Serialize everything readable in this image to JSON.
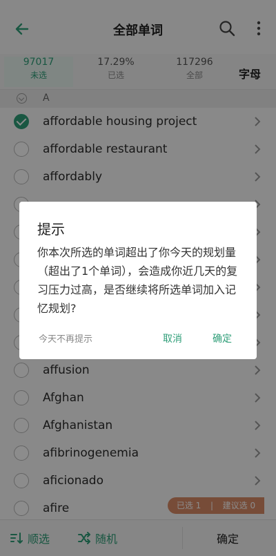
{
  "header": {
    "title": "全部单词",
    "back_icon": "arrow-left-icon",
    "search_icon": "search-icon",
    "more_icon": "more-vertical-icon"
  },
  "stats": [
    {
      "num": "97017",
      "label": "未选"
    },
    {
      "num": "17.29%",
      "label": "已选"
    },
    {
      "num": "117296",
      "label": "全部"
    }
  ],
  "letter_tab": "字母",
  "section": {
    "letter": "A"
  },
  "rows": [
    {
      "word": "affordable housing project",
      "checked": true
    },
    {
      "word": "affordable restaurant",
      "checked": false
    },
    {
      "word": "affordably",
      "checked": false
    },
    {
      "word": "",
      "checked": false
    },
    {
      "word": "",
      "checked": false
    },
    {
      "word": "",
      "checked": false
    },
    {
      "word": "",
      "checked": false
    },
    {
      "word": "",
      "checked": false
    },
    {
      "word": "",
      "checked": false
    },
    {
      "word": "affusion",
      "checked": false
    },
    {
      "word": "Afghan",
      "checked": false
    },
    {
      "word": "Afghanistan",
      "checked": false
    },
    {
      "word": "afibrinogenemia",
      "checked": false
    },
    {
      "word": "aficionado",
      "checked": false
    },
    {
      "word": "afire",
      "checked": false
    }
  ],
  "selection_badge": {
    "selected": "已选 1",
    "separator": "|",
    "suggested": "建议选 0"
  },
  "bottom": {
    "order": "顺选",
    "random": "随机",
    "confirm": "确定"
  },
  "dialog": {
    "title": "提示",
    "message": "你本次所选的单词超出了你今天的规划量（超出了1个单词），会造成你近几天的复习压力过高，是否继续将所选单词加入记忆规划?",
    "never": "今天不再提示",
    "cancel": "取消",
    "ok": "确定"
  },
  "colors": {
    "accent": "#2f9e78",
    "badge": "#d98a67"
  }
}
